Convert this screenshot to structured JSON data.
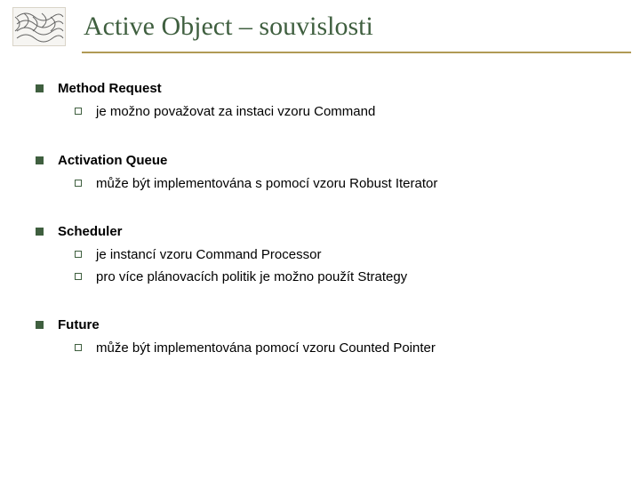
{
  "title": "Active Object – souvislosti",
  "sections": [
    {
      "heading": "Method Request",
      "items": [
        "je možno považovat za instaci vzoru Command"
      ]
    },
    {
      "heading": "Activation Queue",
      "items": [
        "může být implementována s pomocí vzoru Robust Iterator"
      ]
    },
    {
      "heading": "Scheduler",
      "items": [
        "je instancí vzoru Command Processor",
        "pro více plánovacích politik je možno použít Strategy"
      ]
    },
    {
      "heading": "Future",
      "items": [
        "může být implementována pomocí vzoru Counted Pointer"
      ]
    }
  ]
}
